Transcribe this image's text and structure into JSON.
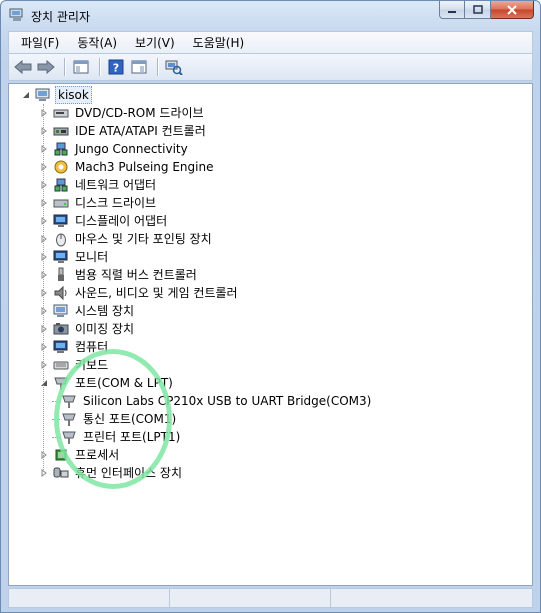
{
  "window": {
    "title": "장치 관리자"
  },
  "menu": [
    "파일(F)",
    "동작(A)",
    "보기(V)",
    "도움말(H)"
  ],
  "tree": {
    "root": "kisok",
    "categories": [
      {
        "label": "DVD/CD-ROM 드라이브",
        "icon": "dvd-drive-icon",
        "expanded": false
      },
      {
        "label": "IDE ATA/ATAPI 컨트롤러",
        "icon": "ide-controller-icon",
        "expanded": false
      },
      {
        "label": "Jungo Connectivity",
        "icon": "network-device-icon",
        "expanded": false
      },
      {
        "label": "Mach3 Pulseing Engine",
        "icon": "gear-device-icon",
        "expanded": false
      },
      {
        "label": "네트워크 어댑터",
        "icon": "network-adapter-icon",
        "expanded": false
      },
      {
        "label": "디스크 드라이브",
        "icon": "disk-drive-icon",
        "expanded": false
      },
      {
        "label": "디스플레이 어댑터",
        "icon": "display-adapter-icon",
        "expanded": false
      },
      {
        "label": "마우스 및 기타 포인팅 장치",
        "icon": "mouse-icon",
        "expanded": false
      },
      {
        "label": "모니터",
        "icon": "monitor-icon",
        "expanded": false
      },
      {
        "label": "범용 직렬 버스 컨트롤러",
        "icon": "usb-icon",
        "expanded": false
      },
      {
        "label": "사운드, 비디오 및 게임 컨트롤러",
        "icon": "speaker-icon",
        "expanded": false
      },
      {
        "label": "시스템 장치",
        "icon": "system-device-icon",
        "expanded": false
      },
      {
        "label": "이미징 장치",
        "icon": "camera-icon",
        "expanded": false
      },
      {
        "label": "컴퓨터",
        "icon": "computer-icon",
        "expanded": false
      },
      {
        "label": "키보드",
        "icon": "keyboard-icon",
        "expanded": false
      },
      {
        "label": "포트(COM & LPT)",
        "icon": "port-icon",
        "expanded": true,
        "children": [
          "Silicon Labs CP210x USB to UART Bridge(COM3)",
          "통신 포트(COM1)",
          "프린터 포트(LPT1)"
        ]
      },
      {
        "label": "프로세서",
        "icon": "processor-icon",
        "expanded": false
      },
      {
        "label": "휴먼 인터페이스 장치",
        "icon": "hid-icon",
        "expanded": false
      }
    ]
  },
  "colors": {
    "highlight_circle": "#7fe6a3",
    "window_frame": "#bfd3ec"
  }
}
